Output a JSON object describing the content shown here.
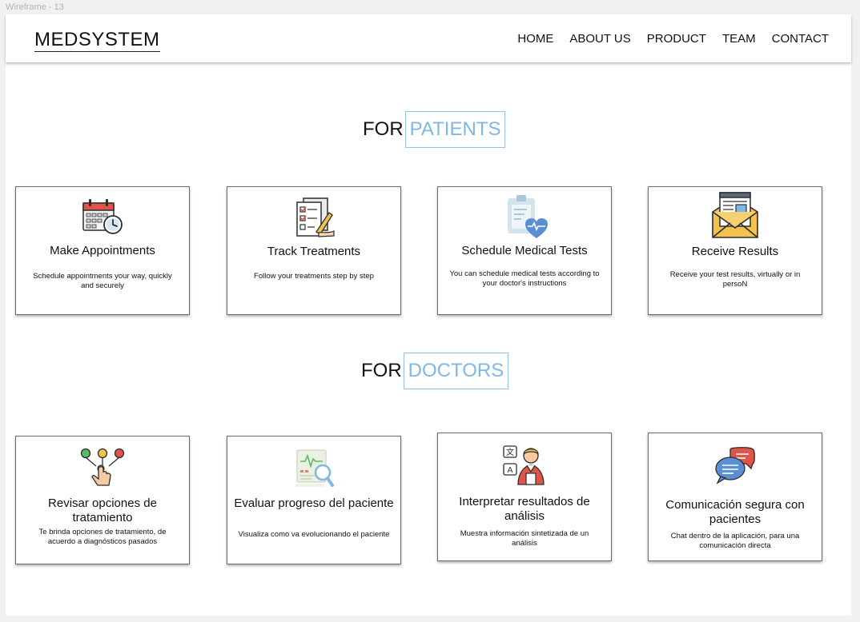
{
  "frame_label": "Wireframe - 13",
  "brand": "MEDSYSTEM",
  "nav": [
    "HOME",
    "ABOUT US",
    "PRODUCT",
    "TEAM",
    "CONTACT"
  ],
  "patients": {
    "title_prefix": "FOR",
    "title_accent": "PATIENTS",
    "cards": [
      {
        "icon": "calendar-clock-icon",
        "title": "Make Appointments",
        "desc": "Schedule appointments your way, quickly and securely"
      },
      {
        "icon": "checklist-pen-icon",
        "title": "Track Treatments",
        "desc": "Follow your treatments step by step"
      },
      {
        "icon": "clipboard-heart-icon",
        "title": "Schedule Medical Tests",
        "desc": "You can schedule medical tests according to your doctor's instructions"
      },
      {
        "icon": "envelope-letter-icon",
        "title": "Receive Results",
        "desc": "Receive your test results, virtually or in persoN"
      }
    ]
  },
  "doctors": {
    "title_prefix": "FOR",
    "title_accent": "DOCTORS",
    "cards": [
      {
        "icon": "hand-choice-icon",
        "title": "Revisar opciones de tratamiento",
        "desc": "Te brinda opciones de tratamiento, de acuerdo a diagnósticos pasados"
      },
      {
        "icon": "report-magnifier-icon",
        "title": "Evaluar progreso del paciente",
        "desc": "Visualiza como va evolucionando el paciente"
      },
      {
        "icon": "doctor-translate-icon",
        "title": "Interpretar resultados de análisis",
        "desc": "Muestra información sintetizada de un análisis"
      },
      {
        "icon": "chat-bubbles-icon",
        "title": "Comunicación segura con pacientes",
        "desc": "Chat dentro de la aplicación, para una comunicación directa"
      }
    ]
  },
  "colors": {
    "accent": "#7fb7e6",
    "border": "#6c6c6c"
  }
}
